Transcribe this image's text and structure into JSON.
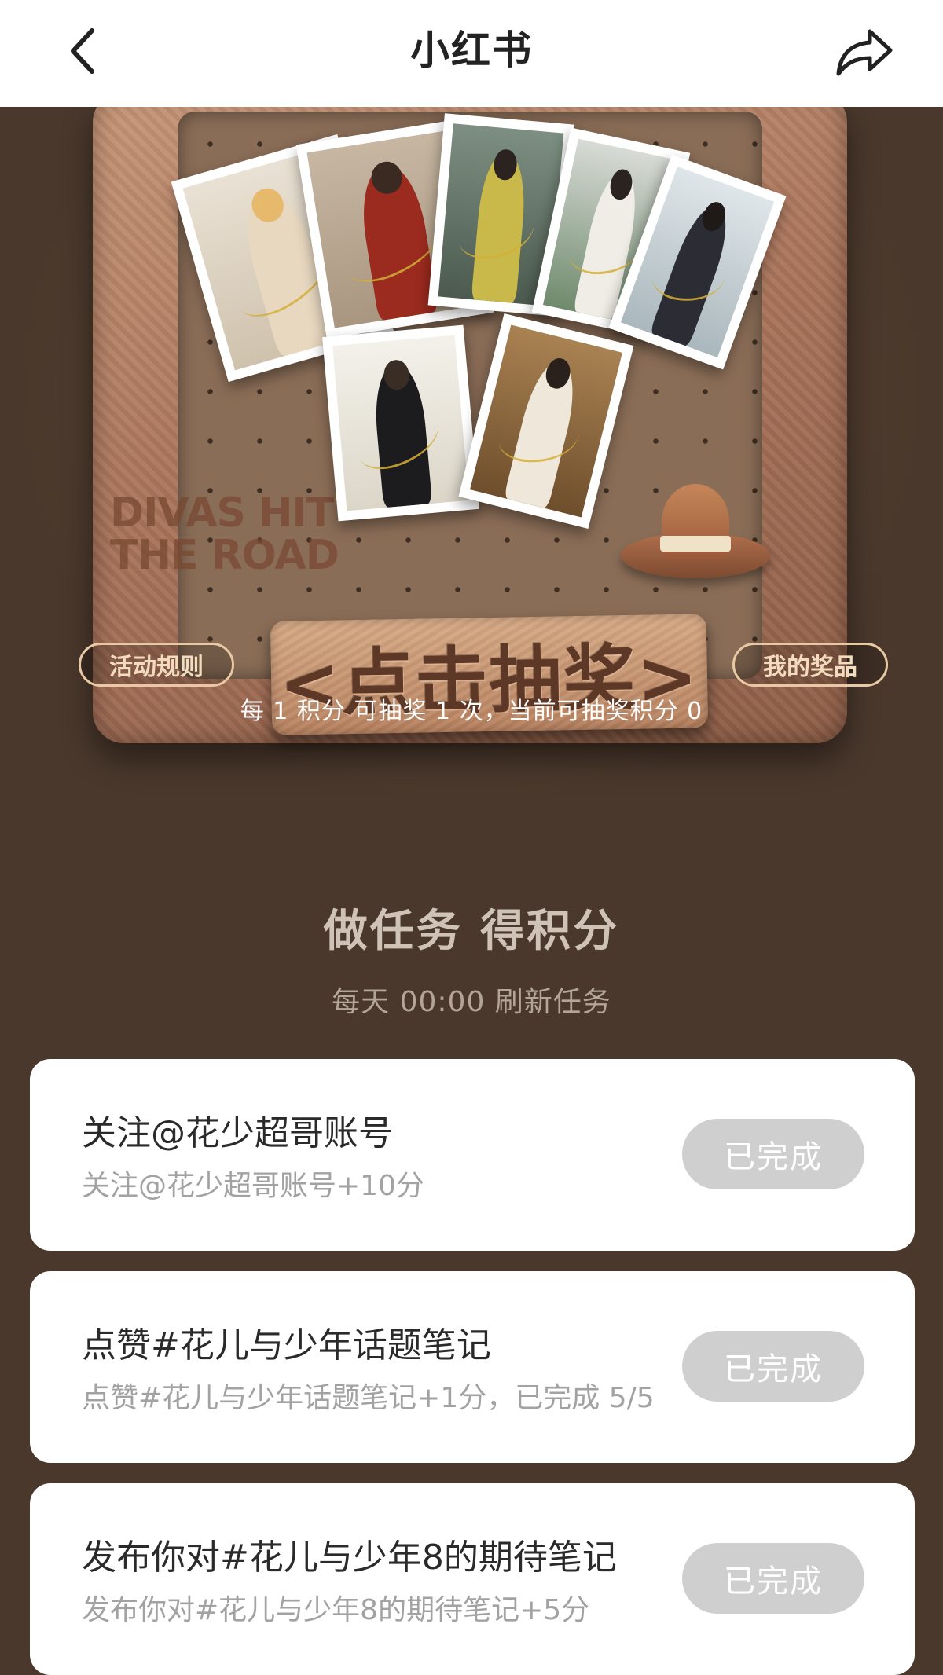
{
  "header": {
    "back_icon": "chevron-left-icon",
    "title": "小红书",
    "share_icon": "share-arrow-icon"
  },
  "banner": {
    "watermark_line1": "DIVAS HIT",
    "watermark_line2": "THE ROAD",
    "draw_button_label": "<点击抽奖>",
    "rules_button_label": "活动规则",
    "prizes_button_label": "我的奖品",
    "points_info": "每 1 积分 可抽奖 1 次，当前可抽奖积分 0"
  },
  "tasks": {
    "title": "做任务 得积分",
    "subtitle": "每天 00:00 刷新任务",
    "items": [
      {
        "name": "关注@花少超哥账号",
        "desc": "关注@花少超哥账号+10分",
        "status": "已完成"
      },
      {
        "name": "点赞#花儿与少年话题笔记",
        "desc": "点赞#花儿与少年话题笔记+1分，已完成 5/5",
        "status": "已完成"
      },
      {
        "name": "发布你对#花儿与少年8的期待笔记",
        "desc": "发布你对#花儿与少年8的期待笔记+5分",
        "status": "已完成"
      }
    ]
  }
}
